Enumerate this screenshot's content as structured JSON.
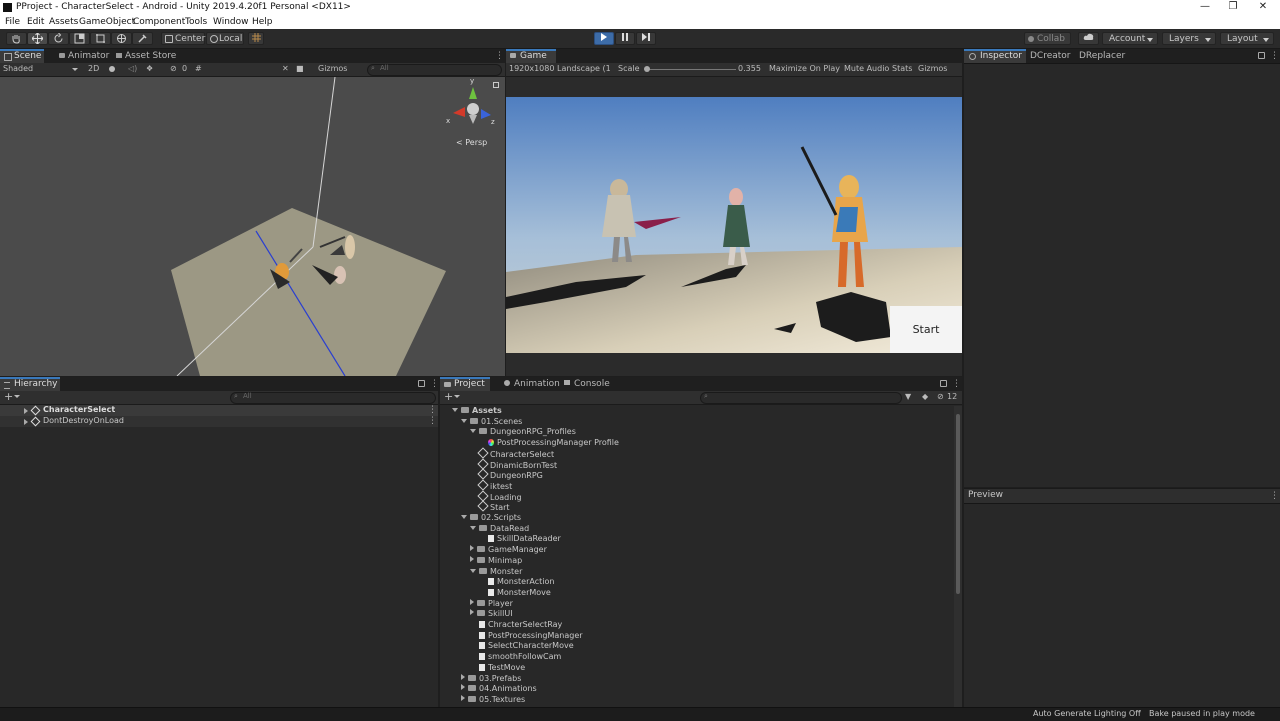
{
  "window": {
    "title": "PProject - CharacterSelect - Android - Unity 2019.4.20f1 Personal <DX11>",
    "minimize": "—",
    "restore": "❐",
    "close": "✕"
  },
  "menu": [
    "File",
    "Edit",
    "Assets",
    "GameObject",
    "Component",
    "Tools",
    "Window",
    "Help"
  ],
  "toolbar": {
    "pivot_label": "Center",
    "space_label": "Local",
    "collab_label": "Collab",
    "account_label": "Account",
    "layers_label": "Layers",
    "layout_label": "Layout"
  },
  "scene_panel": {
    "tabs": [
      "Scene",
      "Animator",
      "Asset Store"
    ],
    "shading_mode": "Shaded",
    "mode_2d": "2D",
    "hidden_count": "0",
    "gizmos_label": "Gizmos",
    "search_placeholder": "All",
    "persp_label": "Persp",
    "axis_x": "x",
    "axis_y": "y",
    "axis_z": "z"
  },
  "game_panel": {
    "tab": "Game",
    "resolution": "1920x1080 Landscape (1",
    "scale_label": "Scale",
    "scale_value": "0.355",
    "maximize_label": "Maximize On Play",
    "mute_label": "Mute Audio",
    "stats_label": "Stats",
    "gizmos_label": "Gizmos",
    "start_button": "Start"
  },
  "inspector_panel": {
    "tabs": [
      "Inspector",
      "DCreator",
      "DReplacer"
    ],
    "preview_label": "Preview"
  },
  "hierarchy_panel": {
    "tab": "Hierarchy",
    "search_placeholder": "All",
    "items": [
      "CharacterSelect",
      "DontDestroyOnLoad"
    ]
  },
  "project_panel": {
    "tabs": [
      "Project",
      "Animation",
      "Console"
    ],
    "badge_count": "12",
    "tree": [
      {
        "label": "Assets",
        "kind": "folder",
        "indent": 0,
        "expanded": true
      },
      {
        "label": "01.Scenes",
        "kind": "folder",
        "indent": 1,
        "expanded": true
      },
      {
        "label": "DungeonRPG_Profiles",
        "kind": "folder",
        "indent": 2,
        "expanded": true
      },
      {
        "label": "PostProcessingManager Profile",
        "kind": "profile",
        "indent": 3
      },
      {
        "label": "CharacterSelect",
        "kind": "scene",
        "indent": 2
      },
      {
        "label": "DinamicBornTest",
        "kind": "scene",
        "indent": 2
      },
      {
        "label": "DungeonRPG",
        "kind": "scene",
        "indent": 2
      },
      {
        "label": "iktest",
        "kind": "scene",
        "indent": 2
      },
      {
        "label": "Loading",
        "kind": "scene",
        "indent": 2
      },
      {
        "label": "Start",
        "kind": "scene",
        "indent": 2
      },
      {
        "label": "02.Scripts",
        "kind": "folder",
        "indent": 1,
        "expanded": true
      },
      {
        "label": "DataRead",
        "kind": "folder",
        "indent": 2,
        "expanded": true
      },
      {
        "label": "SkillDataReader",
        "kind": "script",
        "indent": 3
      },
      {
        "label": "GameManager",
        "kind": "folder",
        "indent": 2,
        "expanded": false
      },
      {
        "label": "Minimap",
        "kind": "folder",
        "indent": 2,
        "expanded": false
      },
      {
        "label": "Monster",
        "kind": "folder",
        "indent": 2,
        "expanded": true
      },
      {
        "label": "MonsterAction",
        "kind": "script",
        "indent": 3
      },
      {
        "label": "MonsterMove",
        "kind": "script",
        "indent": 3
      },
      {
        "label": "Player",
        "kind": "folder",
        "indent": 2,
        "expanded": false
      },
      {
        "label": "SkillUI",
        "kind": "folder",
        "indent": 2,
        "expanded": false
      },
      {
        "label": "ChracterSelectRay",
        "kind": "script",
        "indent": 2
      },
      {
        "label": "PostProcessingManager",
        "kind": "script",
        "indent": 2
      },
      {
        "label": "SelectCharacterMove",
        "kind": "script",
        "indent": 2
      },
      {
        "label": "smoothFollowCam",
        "kind": "script",
        "indent": 2
      },
      {
        "label": "TestMove",
        "kind": "script",
        "indent": 2
      },
      {
        "label": "03.Prefabs",
        "kind": "folder",
        "indent": 1,
        "expanded": false
      },
      {
        "label": "04.Animations",
        "kind": "folder",
        "indent": 1,
        "expanded": false
      },
      {
        "label": "05.Textures",
        "kind": "folder",
        "indent": 1,
        "expanded": false
      }
    ]
  },
  "status_bar": {
    "lighting": "Auto Generate Lighting Off",
    "bake": "Bake paused in play mode"
  }
}
